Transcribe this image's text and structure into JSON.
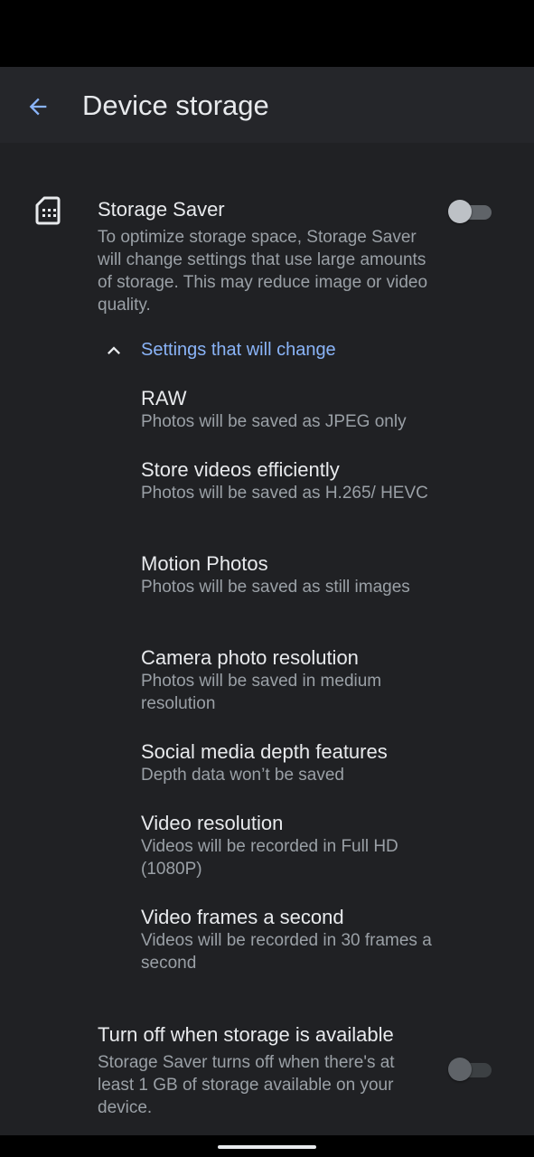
{
  "header": {
    "title": "Device storage"
  },
  "storage_saver": {
    "title": "Storage Saver",
    "summary": "To optimize storage space, Storage Saver will change settings that use large amounts of storage. This may reduce image or video quality.",
    "enabled": false,
    "icon": "sim-card-icon"
  },
  "changes_section": {
    "label": "Settings that will change",
    "expanded": true,
    "items": [
      {
        "title": "RAW",
        "summary": "Photos will be saved as JPEG only"
      },
      {
        "title": "Store videos efficiently",
        "summary": "Photos will be saved as H.265/ HEVC"
      },
      {
        "title": "Motion Photos",
        "summary": "Photos will be saved as still images"
      },
      {
        "title": "Camera photo resolution",
        "summary": "Photos will be saved in medium resolution"
      },
      {
        "title": "Social media depth features",
        "summary": "Depth data won’t be saved"
      },
      {
        "title": "Video resolution",
        "summary": "Videos will be recorded in Full HD (1080P)"
      },
      {
        "title": "Video frames a second",
        "summary": "Videos will be recorded in 30 frames a second"
      }
    ]
  },
  "auto_off": {
    "title": "Turn off when storage is available",
    "summary": "Storage Saver turns off when there's at least 1 GB of storage available on your device.",
    "enabled": false
  },
  "colors": {
    "background": "#202124",
    "app_bar": "#25262a",
    "accent": "#8ab4f8",
    "primary_text": "#e8eaed",
    "secondary_text": "#9aa0a6"
  }
}
